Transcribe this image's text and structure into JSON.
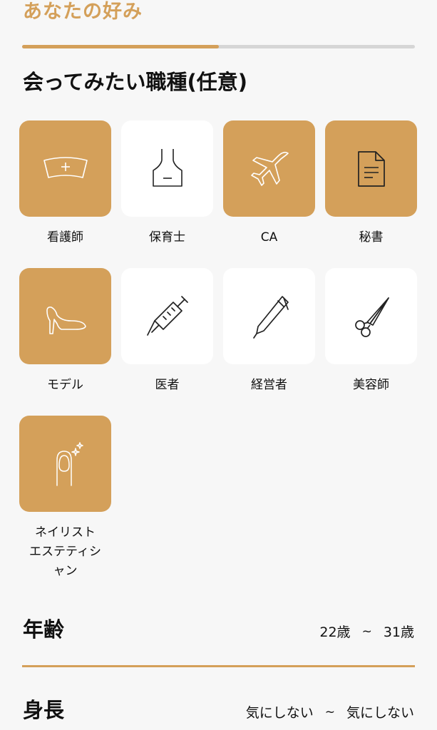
{
  "section_title": "あなたの好み",
  "progress": 0.5,
  "job_heading": "会ってみたい職種(任意)",
  "jobs": [
    {
      "label": "看護師",
      "selected": true,
      "icon": "nurse-cap-icon"
    },
    {
      "label": "保育士",
      "selected": false,
      "icon": "apron-icon"
    },
    {
      "label": "CA",
      "selected": true,
      "icon": "airplane-icon"
    },
    {
      "label": "秘書",
      "selected": true,
      "icon": "document-icon"
    },
    {
      "label": "モデル",
      "selected": true,
      "icon": "high-heel-icon"
    },
    {
      "label": "医者",
      "selected": false,
      "icon": "syringe-icon"
    },
    {
      "label": "経営者",
      "selected": false,
      "icon": "pen-icon"
    },
    {
      "label": "美容師",
      "selected": false,
      "icon": "scissors-icon"
    },
    {
      "label": "ネイリスト\nエステティシ\nャン",
      "selected": true,
      "icon": "nail-icon"
    }
  ],
  "age": {
    "title": "年齢",
    "from": "22歳",
    "sep": "~",
    "to": "31歳"
  },
  "height": {
    "title": "身長",
    "from": "気にしない",
    "sep": "~",
    "to": "気にしない"
  },
  "colors": {
    "accent": "#d4a05a",
    "tile_off": "#ffffff",
    "background": "#f7f7f7"
  }
}
